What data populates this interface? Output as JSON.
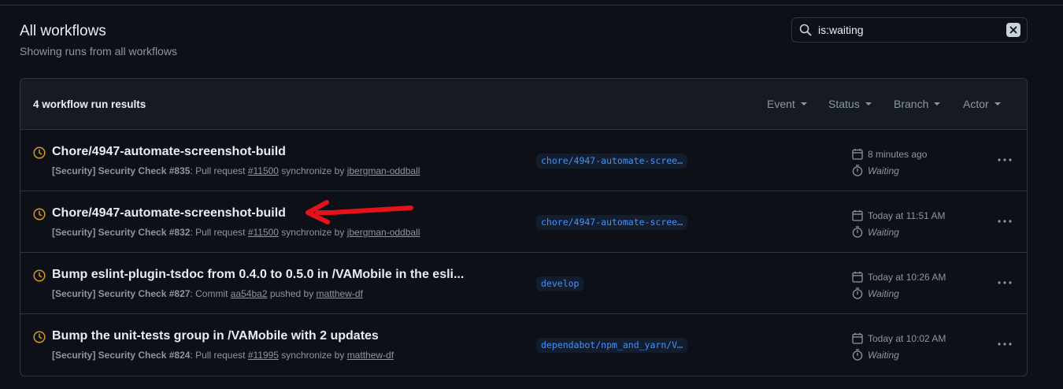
{
  "page": {
    "title": "All workflows",
    "subtitle": "Showing runs from all workflows"
  },
  "search": {
    "value": "is:waiting",
    "icon": "search-icon",
    "clear_icon": "close-icon"
  },
  "panel": {
    "results_count": "4 workflow run results",
    "filters": [
      {
        "label": "Event"
      },
      {
        "label": "Status"
      },
      {
        "label": "Branch"
      },
      {
        "label": "Actor"
      }
    ]
  },
  "runs": [
    {
      "title": "Chore/4947-automate-screenshot-build",
      "workflow": "[Security] Security Check",
      "run_number": "#835",
      "trigger_prefix": ": Pull request ",
      "ref": "#11500",
      "trigger_suffix": " synchronize by ",
      "actor": "jbergman-oddball",
      "branch": "chore/4947-automate-scree…",
      "time": "8 minutes ago",
      "status": "Waiting"
    },
    {
      "title": "Chore/4947-automate-screenshot-build",
      "workflow": "[Security] Security Check",
      "run_number": "#832",
      "trigger_prefix": ": Pull request ",
      "ref": "#11500",
      "trigger_suffix": " synchronize by ",
      "actor": "jbergman-oddball",
      "branch": "chore/4947-automate-scree…",
      "time": "Today at 11:51 AM",
      "status": "Waiting"
    },
    {
      "title": "Bump eslint-plugin-tsdoc from 0.4.0 to 0.5.0 in /VAMobile in the esli...",
      "workflow": "[Security] Security Check",
      "run_number": "#827",
      "trigger_prefix": ": Commit ",
      "ref": "aa54ba2",
      "trigger_suffix": " pushed by ",
      "actor": "matthew-df",
      "branch": "develop",
      "time": "Today at 10:26 AM",
      "status": "Waiting"
    },
    {
      "title": "Bump the unit-tests group in /VAMobile with 2 updates",
      "workflow": "[Security] Security Check",
      "run_number": "#824",
      "trigger_prefix": ": Pull request ",
      "ref": "#11995",
      "trigger_suffix": " synchronize by ",
      "actor": "matthew-df",
      "branch": "dependabot/npm_and_yarn/V…",
      "time": "Today at 10:02 AM",
      "status": "Waiting"
    }
  ],
  "colors": {
    "waiting": "#d29922",
    "annotation_arrow": "#e5121c",
    "branch_text": "#4493f8"
  }
}
